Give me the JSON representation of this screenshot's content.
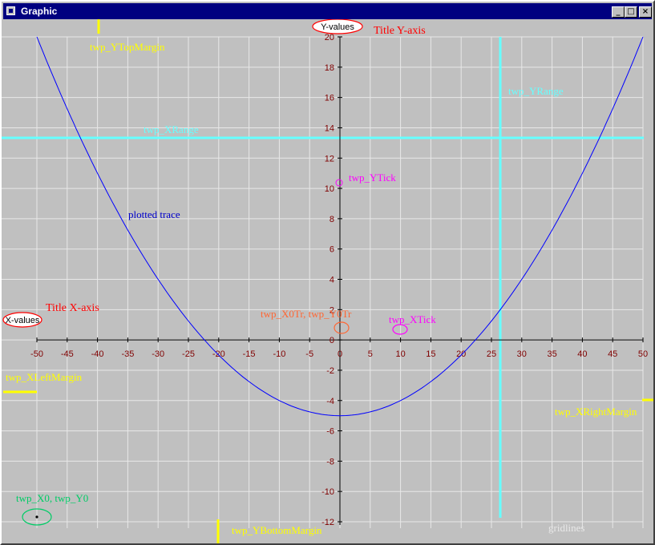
{
  "window": {
    "title": "Graphic",
    "minimize_glyph": "_",
    "maximize_glyph": "□",
    "close_glyph": "×"
  },
  "chart_data": {
    "type": "line",
    "xlim": [
      -50,
      50
    ],
    "ylim": [
      -12,
      20
    ],
    "x_ticks": [
      -50,
      -45,
      -40,
      -35,
      -30,
      -25,
      -20,
      -15,
      -10,
      -5,
      0,
      5,
      10,
      15,
      20,
      25,
      30,
      35,
      40,
      45,
      50
    ],
    "y_ticks": [
      -12,
      -10,
      -8,
      -6,
      -4,
      -2,
      0,
      2,
      4,
      6,
      8,
      10,
      12,
      14,
      16,
      18,
      20
    ],
    "grid": true,
    "series": [
      {
        "color": "#0000ff",
        "x": [
          -50,
          -45,
          -40,
          -35,
          -30,
          -25,
          -20,
          -15,
          -10,
          -5,
          0,
          5,
          10,
          15,
          20,
          25,
          30,
          35,
          40,
          45,
          50
        ],
        "y": [
          20,
          15.25,
          11,
          7.25,
          4,
          1.25,
          -1,
          -2.75,
          -4,
          -4.75,
          -5,
          -4.75,
          -4,
          -2.75,
          -1,
          1.25,
          4,
          7.25,
          11,
          15.25,
          20
        ]
      }
    ],
    "xlabel_badge": "X-values",
    "ylabel_badge": "Y-values",
    "title_x": "Title X-axis",
    "title_y": "Title Y-axis",
    "annotations": {
      "ytop_margin": "twp_YTopMargin",
      "xrange": "twp_XRange",
      "yrange": "twp_YRange",
      "ytick": "twp_YTick",
      "plotted_trace": "plotted trace",
      "origin_tr": "twp_X0Tr, twp_Y0Tr",
      "xtick": "twp_XTick",
      "xleft_margin": "twp_XLeftMargin",
      "xright_margin": "twp_XRightMargin",
      "x0y0": "twp_X0, twp_Y0",
      "ybottom_margin": "twp_YBottomMargin",
      "gridlines": "gridlines"
    },
    "colors": {
      "background": "#c0c0c0",
      "grid": "#e8e8e8",
      "axis": "#000000",
      "tick_label": "#800000",
      "trace": "#0000ff",
      "cyan": "#66ffff",
      "yellow": "#ffff00",
      "magenta": "#ff00ff",
      "orange": "#ff6633",
      "red": "#ff0000",
      "green": "#00cc66"
    }
  }
}
